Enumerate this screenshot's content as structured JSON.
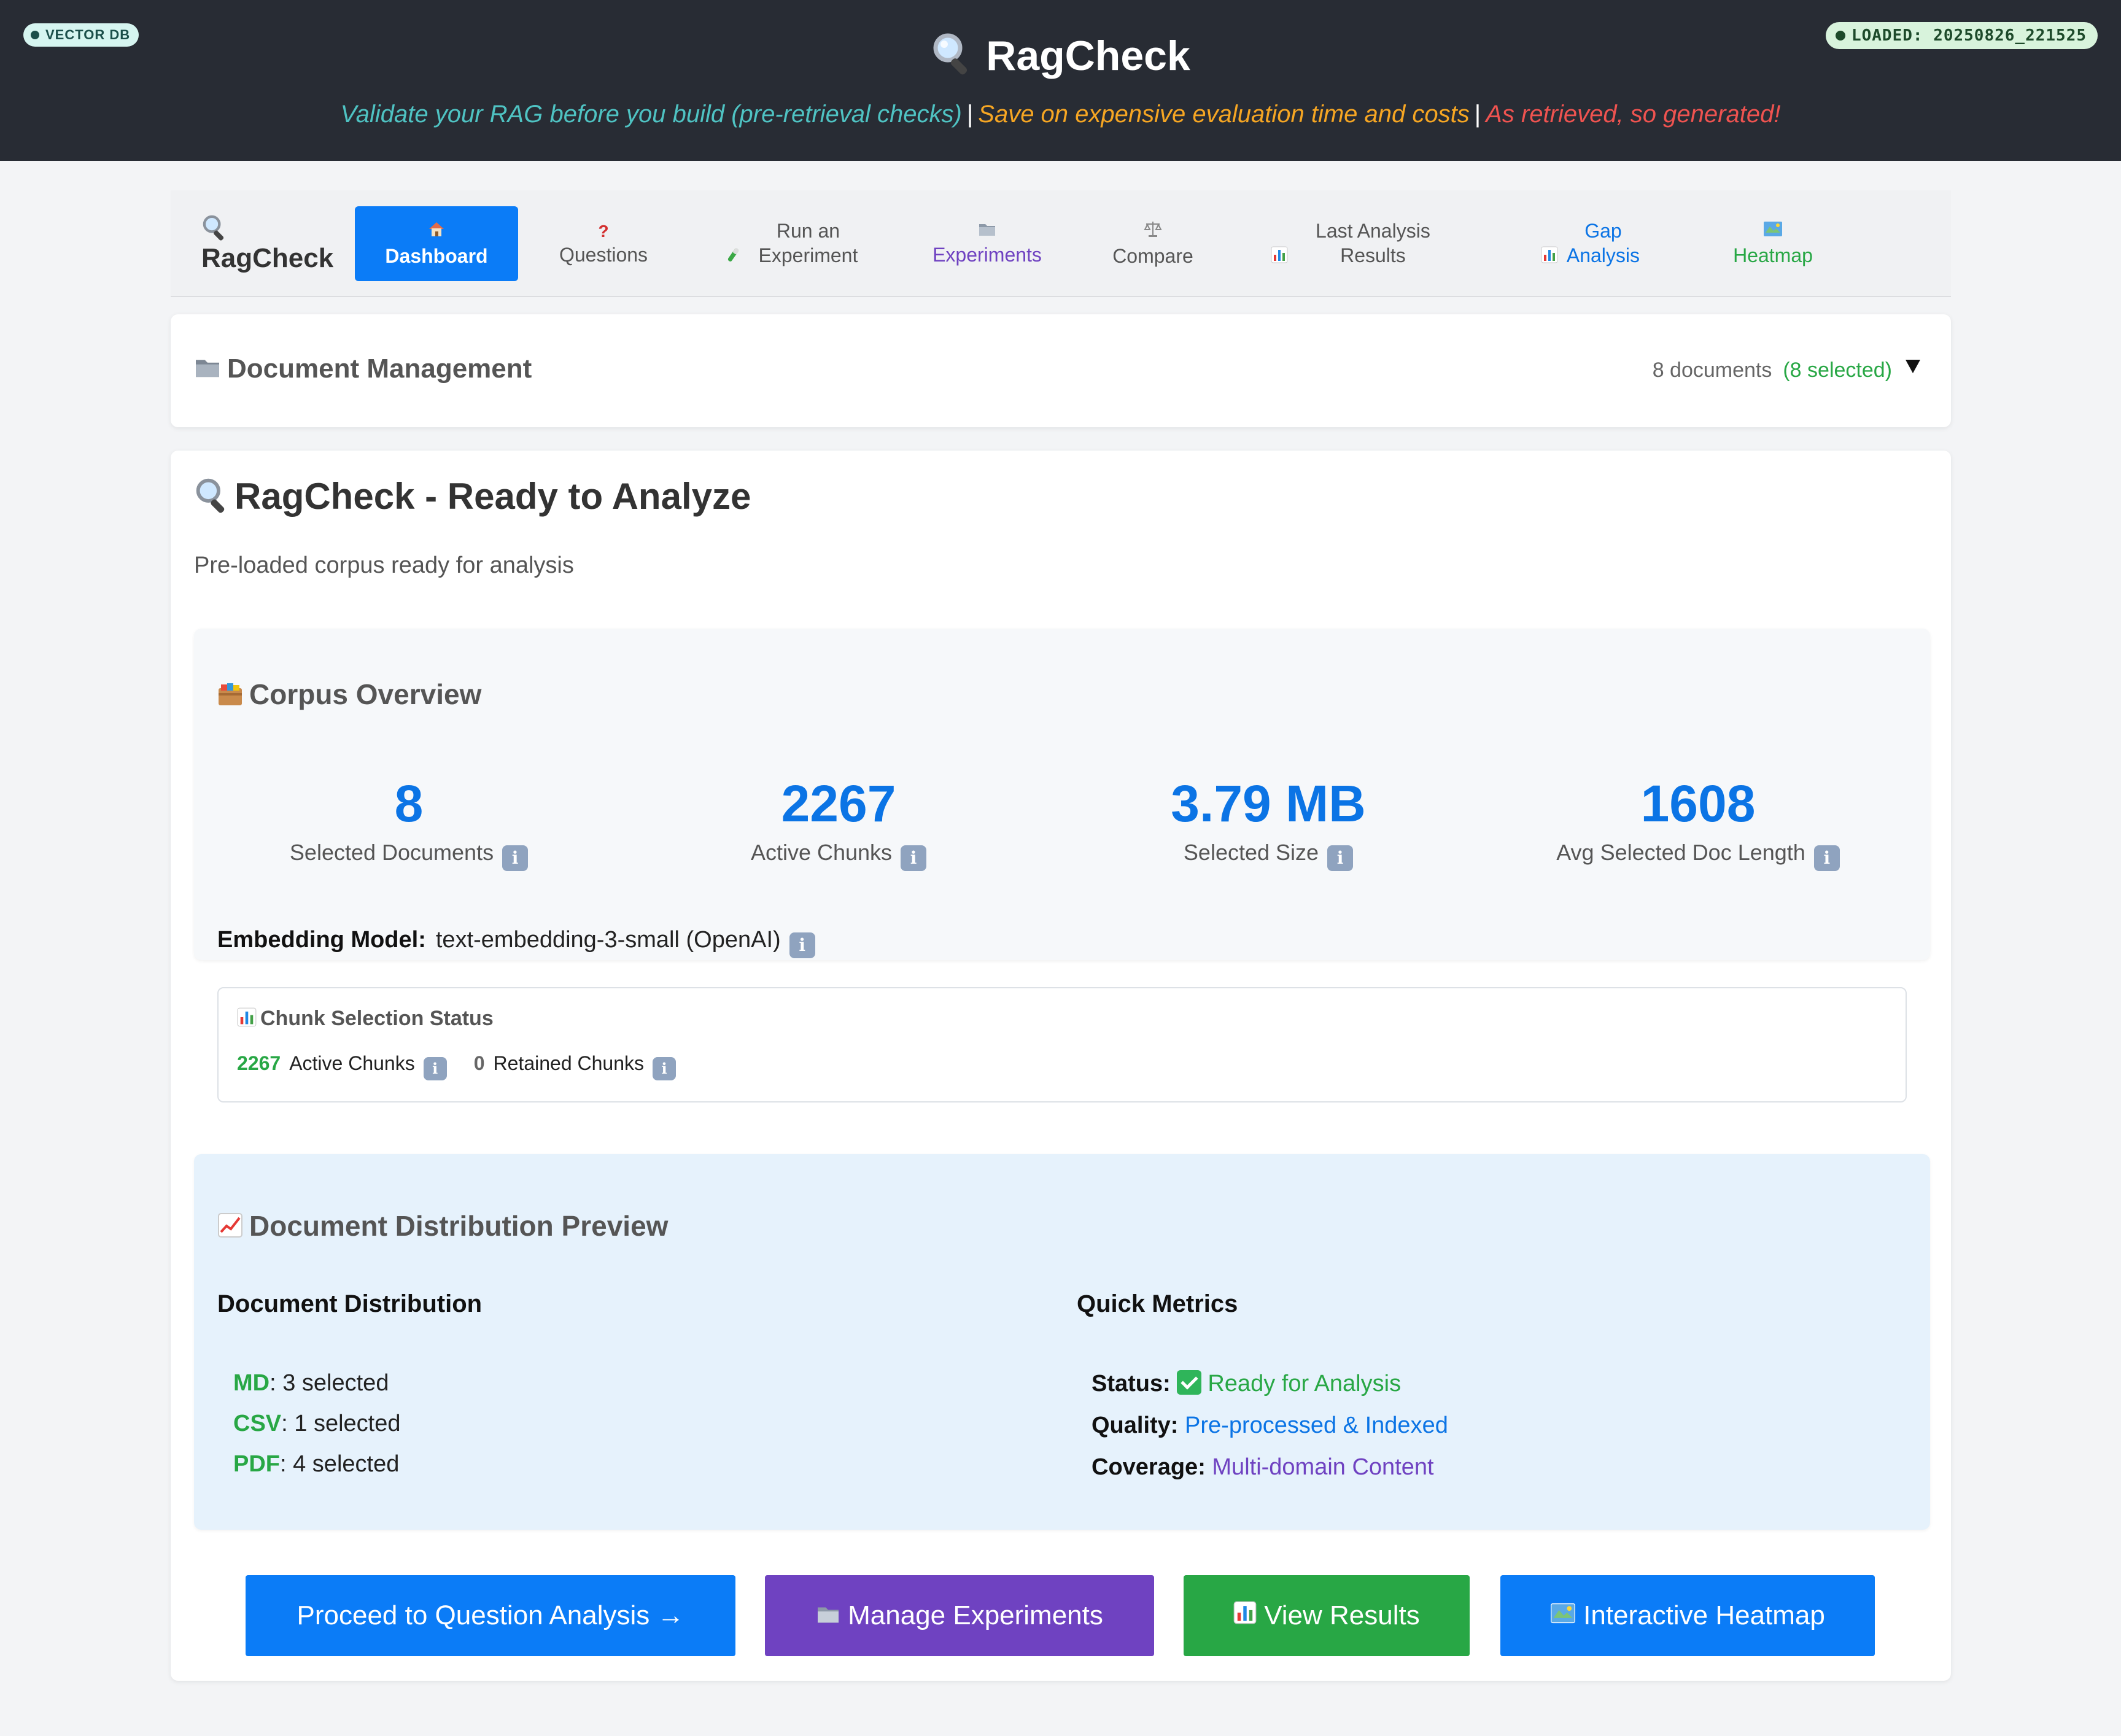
{
  "header": {
    "left_badge": "VECTOR DB",
    "right_badge": "LOADED: 20250826_221525",
    "title": "RagCheck",
    "tagline": {
      "part1": "Validate your RAG before you build (pre-retrieval checks)",
      "separator": "|",
      "part2": "Save on expensive evaluation time and costs",
      "part3": "As retrieved, so generated!"
    },
    "colors": {
      "part1": "#4fc3c3",
      "part2": "#f6a623",
      "part3": "#ef5350"
    }
  },
  "nav": {
    "brand": "RagCheck",
    "items": [
      {
        "icon": "house-icon",
        "label": "Dashboard",
        "active": true
      },
      {
        "icon": "question-icon",
        "label": "Questions"
      },
      {
        "icon": "test-tube-icon",
        "label": "Run an Experiment"
      },
      {
        "icon": "folder-icon",
        "label": "Experiments"
      },
      {
        "icon": "scales-icon",
        "label": "Compare"
      },
      {
        "icon": "bar-chart-icon",
        "label": "Last Analysis Results"
      },
      {
        "icon": "bar-chart-icon",
        "label": "Gap Analysis"
      },
      {
        "icon": "map-icon",
        "label": "Heatmap"
      }
    ],
    "accent": "#0b7cf7"
  },
  "doc_management": {
    "title": "Document Management",
    "count": "8 documents",
    "selected": "(8 selected)"
  },
  "main": {
    "title": "RagCheck - Ready to Analyze",
    "subtitle": "Pre-loaded corpus ready for analysis",
    "corpus": {
      "title": "Corpus Overview",
      "stats": [
        {
          "value": "8",
          "label": "Selected Documents"
        },
        {
          "value": "2267",
          "label": "Active Chunks"
        },
        {
          "value": "3.79 MB",
          "label": "Selected Size"
        },
        {
          "value": "1608",
          "label": "Avg Selected Doc Length"
        }
      ],
      "embedding_label": "Embedding Model:",
      "embedding_value": "text-embedding-3-small (OpenAI)",
      "chunk_status": {
        "title": "Chunk Selection Status",
        "active_count": "2267",
        "active_label": "Active Chunks",
        "retained_count": "0",
        "retained_label": "Retained Chunks"
      }
    },
    "distribution": {
      "title": "Document Distribution Preview",
      "left_heading": "Document Distribution",
      "types": [
        {
          "type": "MD",
          "text": ": 3 selected"
        },
        {
          "type": "CSV",
          "text": ": 1 selected"
        },
        {
          "type": "PDF",
          "text": ": 4 selected"
        }
      ],
      "right_heading": "Quick Metrics",
      "metrics": [
        {
          "label": "Status:",
          "value": "Ready for Analysis",
          "color": "#28a745"
        },
        {
          "label": "Quality:",
          "value": "Pre-processed & Indexed",
          "color": "#0b74e5"
        },
        {
          "label": "Coverage:",
          "value": "Multi-domain Content",
          "color": "#6f42c1"
        }
      ]
    },
    "buttons": {
      "proceed": "Proceed to Question Analysis →",
      "manage": "Manage Experiments",
      "view": "View Results",
      "heatmap": "Interactive Heatmap"
    }
  }
}
